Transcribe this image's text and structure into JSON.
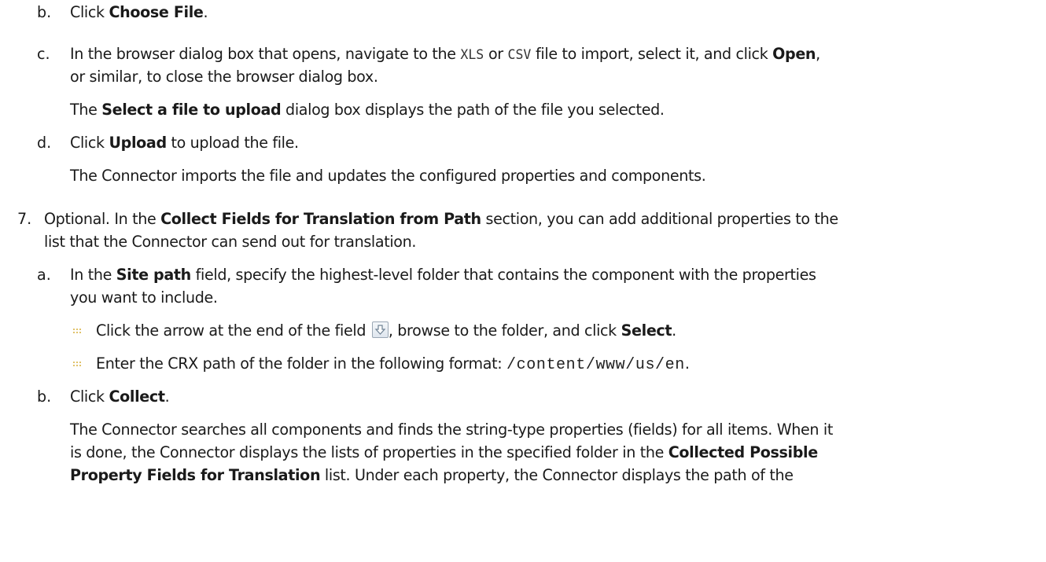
{
  "steps": {
    "b1": {
      "marker": "b.",
      "text_before": "Click ",
      "bold": "Choose File",
      "text_after": "."
    },
    "c1": {
      "marker": "c.",
      "line1_a": "In the browser dialog box that opens, navigate to the ",
      "code1": "XLS",
      "line1_b": " or ",
      "code2": "CSV",
      "line1_c": " file to import, select it, and click ",
      "bold": "Open",
      "line1_d": ",",
      "line2": "or similar, to close the browser dialog box."
    },
    "c1_result": {
      "text_a": "The ",
      "bold": "Select a file to upload",
      "text_b": " dialog box displays the path of the file you selected."
    },
    "d1": {
      "marker": "d.",
      "text_a": "Click ",
      "bold": "Upload",
      "text_b": " to upload the file."
    },
    "d1_result": "The Connector imports the file and updates the configured properties and components.",
    "step7": {
      "marker": "7.",
      "line1_a": "Optional. In the ",
      "bold": "Collect Fields for Translation from Path",
      "line1_b": " section, you can add additional properties to the",
      "line2": "list that the Connector can send out for translation."
    },
    "a2": {
      "marker": "a.",
      "line1_a": "In the ",
      "bold": "Site path",
      "line1_b": " field, specify the highest-level folder that contains the component with the properties",
      "line2": "you want to include."
    },
    "bullets": [
      {
        "text_a": "Click the arrow at the end of the field ",
        "icon": "arrow-down-icon",
        "text_b": ", browse to the folder, and click ",
        "bold": "Select",
        "text_c": "."
      },
      {
        "text_a": "Enter the CRX path of the folder in the following format: ",
        "code": "/content/www/us/en",
        "text_b": "."
      }
    ],
    "b2": {
      "marker": "b.",
      "text_a": "Click ",
      "bold": "Collect",
      "text_b": "."
    },
    "b2_result": {
      "line1": "The Connector searches all components and finds the string-type properties (fields) for all items. When it",
      "line2_a": "is done, the Connector displays the lists of properties in the specified folder in the ",
      "line2_bold": "Collected Possible",
      "line3_bold": "Property Fields for Translation",
      "line3_b": " list. Under each property, the Connector displays the path of the"
    }
  },
  "colors": {
    "text": "#1a1a1a",
    "bullet": "#e0c26a"
  }
}
